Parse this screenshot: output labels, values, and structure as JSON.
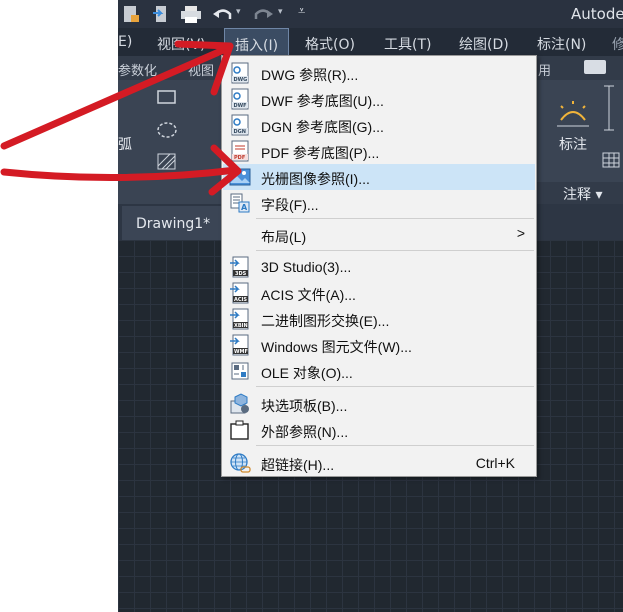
{
  "app": {
    "title_fragment": "Autode"
  },
  "menubar": {
    "items": [
      {
        "label": "E)"
      },
      {
        "label": "视图(V)"
      },
      {
        "label": "插入(I)"
      },
      {
        "label": "格式(O)"
      },
      {
        "label": "工具(T)"
      },
      {
        "label": "绘图(D)"
      },
      {
        "label": "标注(N)"
      }
    ]
  },
  "ribbon": {
    "tab_fragment_1": "参数化",
    "tab_fragment_2": "视图",
    "tab_fragment_3": "用",
    "arc_label": "弧",
    "annotate_label": "标注",
    "annotate_panel": "注释 ▾"
  },
  "doc_tab": {
    "label": "Drawing1*"
  },
  "menu": {
    "items": [
      {
        "label": "DWG 参照(R)...",
        "icon": "dwg-icon"
      },
      {
        "label": "DWF 参考底图(U)...",
        "icon": "dwf-icon"
      },
      {
        "label": "DGN 参考底图(G)...",
        "icon": "dgn-icon"
      },
      {
        "label": "PDF 参考底图(P)...",
        "icon": "pdf-icon"
      },
      {
        "label": "光栅图像参照(I)...",
        "icon": "raster-image-icon",
        "highlighted": true
      },
      {
        "label": "字段(F)...",
        "icon": "field-icon"
      },
      {
        "label": "布局(L)",
        "submenu_arrow": ">"
      },
      {
        "label": "3D Studio(3)...",
        "icon": "3ds-icon"
      },
      {
        "label": "ACIS 文件(A)...",
        "icon": "acis-icon"
      },
      {
        "label": "二进制图形交换(E)...",
        "icon": "dxb-icon"
      },
      {
        "label": "Windows 图元文件(W)...",
        "icon": "wmf-icon"
      },
      {
        "label": "OLE 对象(O)...",
        "icon": "ole-icon"
      },
      {
        "label": "块选项板(B)...",
        "icon": "block-palette-icon"
      },
      {
        "label": "外部参照(N)...",
        "icon": "xref-icon"
      },
      {
        "label": "超链接(H)...",
        "icon": "hyperlink-icon",
        "shortcut": "Ctrl+K"
      }
    ]
  },
  "colors": {
    "highlight": "#cce4f7",
    "annotation_red": "#d41b24",
    "menubar_bg": "#232b37",
    "canvas_bg": "#212830"
  }
}
